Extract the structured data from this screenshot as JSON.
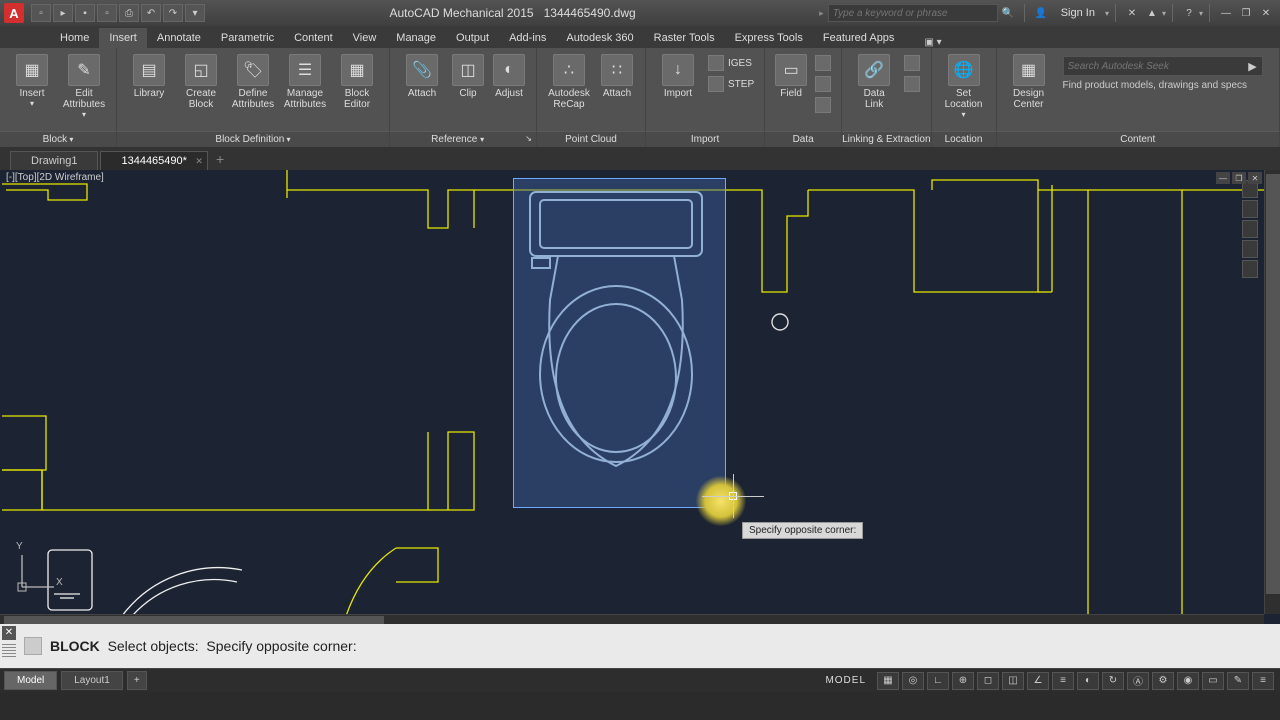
{
  "app": {
    "title": "AutoCAD Mechanical 2015",
    "filename": "1344465490.dwg"
  },
  "title_search_placeholder": "Type a keyword or phrase",
  "signin": "Sign In",
  "tabs": [
    "Home",
    "Insert",
    "Annotate",
    "Parametric",
    "Content",
    "View",
    "Manage",
    "Output",
    "Add-ins",
    "Autodesk 360",
    "Raster Tools",
    "Express Tools",
    "Featured Apps"
  ],
  "active_tab": "Insert",
  "ribbon": {
    "block": {
      "insert": "Insert",
      "edit_attrib": "Edit\nAttributes",
      "title": "Block"
    },
    "library": {
      "library": "Library",
      "create_block": "Create\nBlock",
      "define_attrib": "Define\nAttributes",
      "manage_attrib": "Manage\nAttributes",
      "block_editor": "Block\nEditor",
      "title": "Block Definition"
    },
    "reference": {
      "attach": "Attach",
      "clip": "Clip",
      "adjust": "Adjust",
      "title": "Reference"
    },
    "pointcloud": {
      "recap": "Autodesk\nReCap",
      "attach": "Attach",
      "title": "Point Cloud"
    },
    "import": {
      "import": "Import",
      "iges": "IGES",
      "step": "STEP",
      "title": "Import"
    },
    "data": {
      "field": "Field",
      "title": "Data"
    },
    "linking": {
      "datalink": "Data\nLink",
      "title": "Linking & Extraction"
    },
    "location": {
      "setloc": "Set\nLocation",
      "title": "Location"
    },
    "content": {
      "design_center": "Design\nCenter",
      "search_placeholder": "Search Autodesk Seek",
      "desc": "Find product models, drawings and specs",
      "title": "Content"
    }
  },
  "doctabs": {
    "tab1": "Drawing1",
    "tab2": "1344465490*"
  },
  "viewport_label": "[-][Top][2D Wireframe]",
  "tooltip": "Specify opposite corner:",
  "cmdline": {
    "cmd": "BLOCK",
    "prompt1": "Select objects:",
    "prompt2": "Specify opposite corner:"
  },
  "status": {
    "model": "Model",
    "layout1": "Layout1",
    "model_label": "MODEL"
  },
  "ucs": {
    "x": "X",
    "y": "Y"
  }
}
